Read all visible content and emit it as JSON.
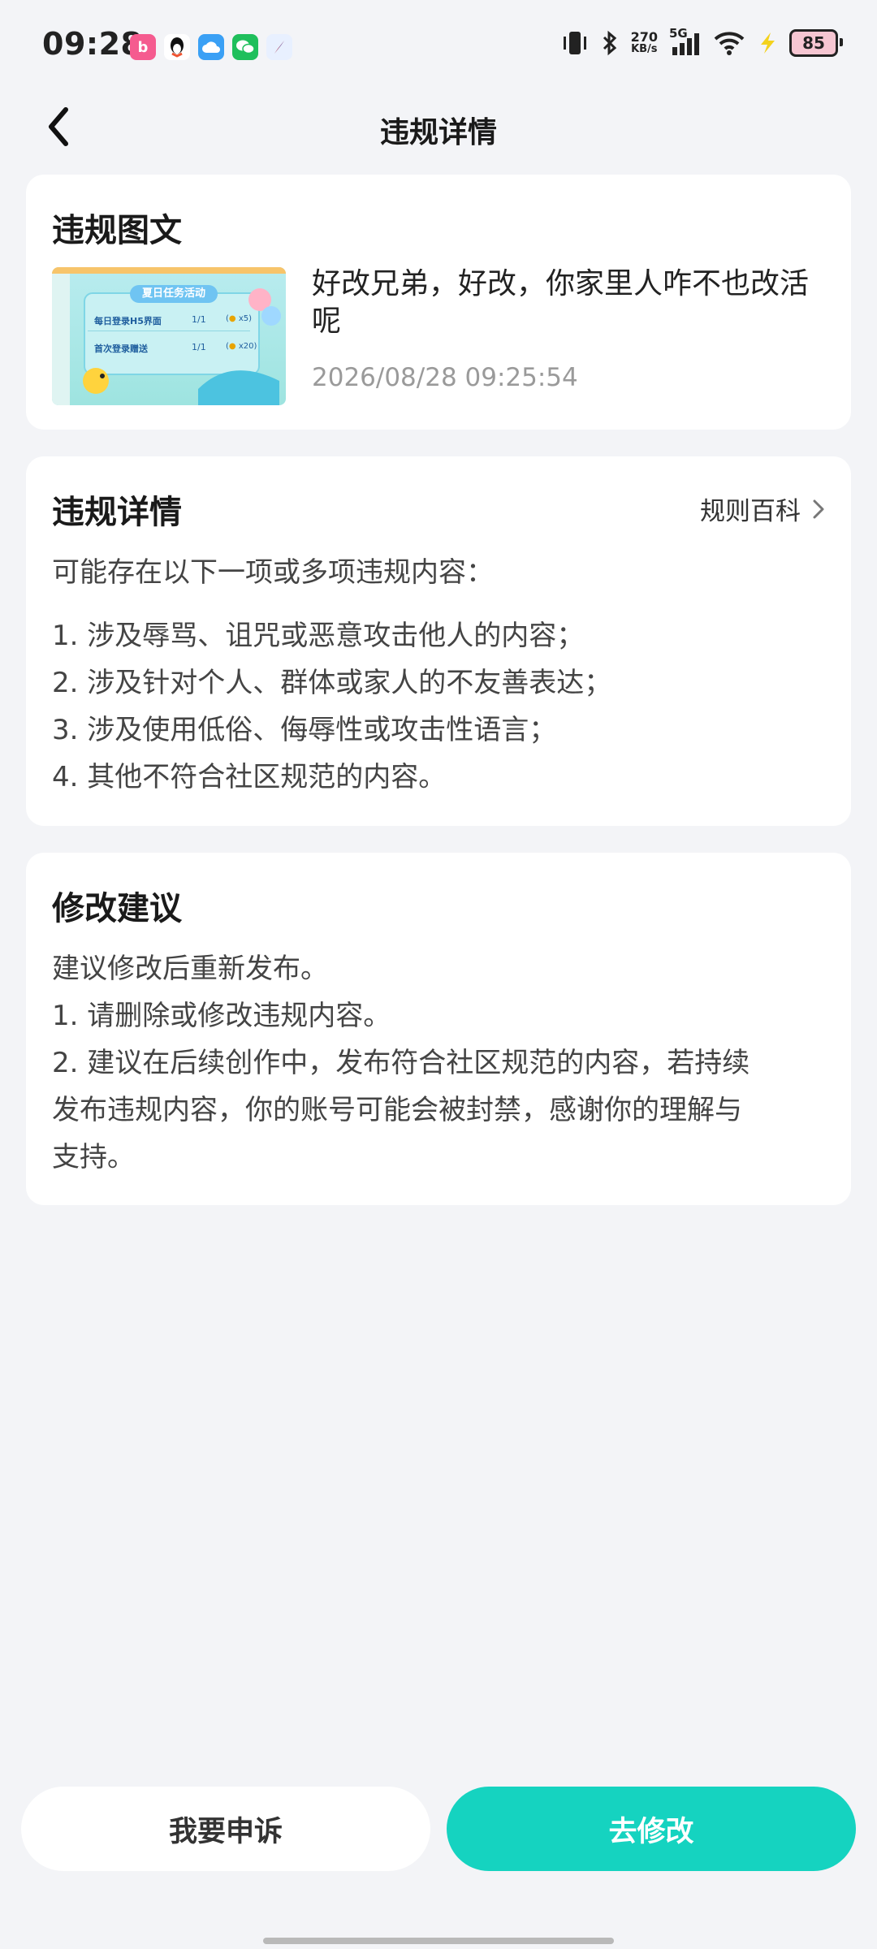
{
  "status_bar": {
    "time": "09:28",
    "net_speed_value": "270",
    "net_speed_unit": "KB/s",
    "network_type": "5G",
    "battery": "85",
    "app_icons": [
      "bilibili-icon",
      "qq-icon",
      "cloud-icon",
      "wechat-icon",
      "compass-icon"
    ]
  },
  "header": {
    "title": "违规详情"
  },
  "post_card": {
    "title": "违规图文",
    "text": "好改兄弟，好改，你家里人咋不也改活呢",
    "timestamp": "2026/08/28 09:25:54",
    "thumbnail": {
      "banner": "夏日任务活动",
      "row1_label": "每日登录H5界面",
      "row1_progress": "1/1",
      "row1_reward": "x5",
      "row2_label": "首次登录赠送",
      "row2_progress": "1/1",
      "row2_reward": "x20"
    }
  },
  "violation_card": {
    "title": "违规详情",
    "rules_link": "规则百科",
    "intro": "可能存在以下一项或多项违规内容：",
    "items": [
      "1. 涉及辱骂、诅咒或恶意攻击他人的内容；",
      "2. 涉及针对个人、群体或家人的不友善表达；",
      "3. 涉及使用低俗、侮辱性或攻击性语言；",
      "4. 其他不符合社区规范的内容。"
    ]
  },
  "suggestion_card": {
    "title": "修改建议",
    "lines": [
      "建议修改后重新发布。",
      "1. 请删除或修改违规内容。",
      "2. 建议在后续创作中，发布符合社区规范的内容，若持续",
      "发布违规内容，你的账号可能会被封禁，感谢你的理解与",
      "支持。"
    ]
  },
  "actions": {
    "appeal": "我要申诉",
    "modify": "去修改"
  },
  "colors": {
    "accent": "#15d3c0",
    "background": "#f3f4f7"
  }
}
